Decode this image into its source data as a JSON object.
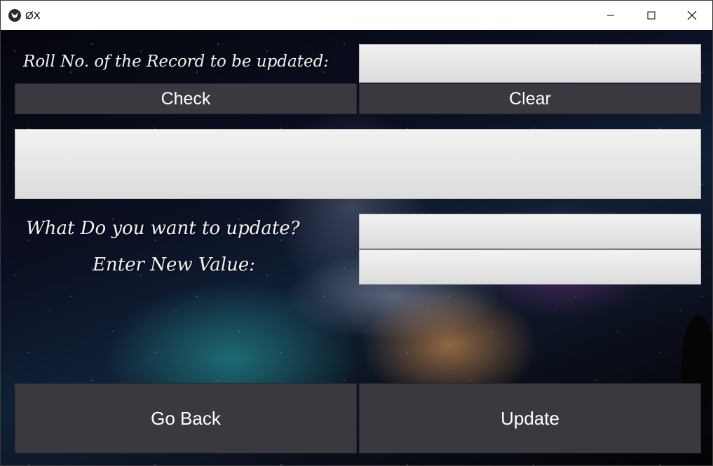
{
  "window": {
    "title": "ØX"
  },
  "form": {
    "roll_label": "Roll No. of the Record to be updated:",
    "roll_input_value": "",
    "check_label": "Check",
    "clear_label": "Clear",
    "record_display_value": "",
    "field_label": "What Do you want to update?",
    "field_input_value": "",
    "new_value_label": "Enter New Value:",
    "new_value_input_value": "",
    "go_back_label": "Go Back",
    "update_label": "Update"
  },
  "colors": {
    "button_bg": "#3a393f",
    "input_bg": "#e8e8e8",
    "label_text": "#f2f2f2"
  }
}
